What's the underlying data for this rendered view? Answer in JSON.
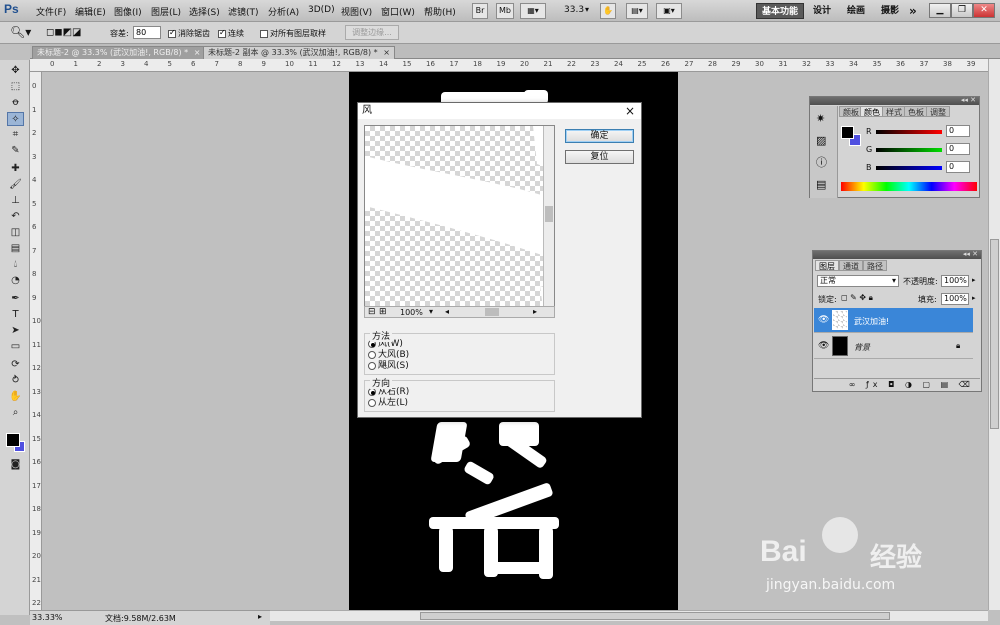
{
  "menubar": {
    "logo": "Ps",
    "menus": [
      "文件(F)",
      "编辑(E)",
      "图像(I)",
      "图层(L)",
      "选择(S)",
      "滤镜(T)",
      "分析(A)",
      "3D(D)",
      "视图(V)",
      "窗口(W)",
      "帮助(H)"
    ],
    "br_label": "Br",
    "mb_label": "Mb",
    "zoom": "33.3",
    "workspaces": [
      "基本功能",
      "设计",
      "绘画",
      "摄影"
    ],
    "more": "»"
  },
  "options": {
    "tolerance_label": "容差:",
    "tolerance_value": "80",
    "anti_alias": "消除锯齿",
    "contiguous": "连续",
    "all_layers": "对所有图层取样",
    "refine_edge": "调整边缘..."
  },
  "tabs": [
    {
      "label": "未标题-2 @ 33.3% (武汉加油!, RGB/8) *",
      "close": "×"
    },
    {
      "label": "未标题-2 副本 @ 33.3% (武汉加油!, RGB/8) *",
      "close": "×"
    }
  ],
  "status": {
    "zoom": "33.33%",
    "doc": "文档:9.58M/2.63M"
  },
  "ruler_labels": [
    "0",
    "1",
    "2",
    "3",
    "4",
    "5",
    "6",
    "7",
    "8",
    "9",
    "10",
    "11",
    "12",
    "13",
    "14",
    "15",
    "16",
    "17",
    "18",
    "19",
    "20",
    "21",
    "22",
    "23",
    "24",
    "25",
    "26",
    "27",
    "28",
    "29",
    "30",
    "31",
    "32",
    "33",
    "34",
    "35",
    "36",
    "37",
    "38",
    "39"
  ],
  "dialog": {
    "title": "风",
    "close": "×",
    "ok": "确定",
    "reset": "复位",
    "zoom": "100%",
    "method_title": "方法",
    "methods": [
      "风(W)",
      "大风(B)",
      "飓风(S)"
    ],
    "direction_title": "方向",
    "directions": [
      "从右(R)",
      "从左(L)"
    ]
  },
  "color_panel": {
    "tabs": [
      "颜板",
      "颜色",
      "样式",
      "色板",
      "调整"
    ],
    "channels": [
      {
        "label": "R",
        "value": "0"
      },
      {
        "label": "G",
        "value": "0"
      },
      {
        "label": "B",
        "value": "0"
      }
    ]
  },
  "layers_panel": {
    "tabs": [
      "图层",
      "通道",
      "路径"
    ],
    "blend_mode": "正常",
    "opacity_label": "不透明度:",
    "opacity_value": "100%",
    "lock_label": "锁定:",
    "fill_label": "填充:",
    "fill_value": "100%",
    "layers": [
      {
        "name": "武汉加油!",
        "selected": true
      },
      {
        "name": "背景",
        "selected": false
      }
    ]
  },
  "watermark": {
    "brand": "Bai",
    "brand2": "经验",
    "url": "jingyan.baidu.com"
  },
  "colors": {
    "accent": "#3b7fd9",
    "selected_layer": "#3a86d8",
    "canvas": "#000000",
    "workspace_bg": "#c0c0c0"
  }
}
